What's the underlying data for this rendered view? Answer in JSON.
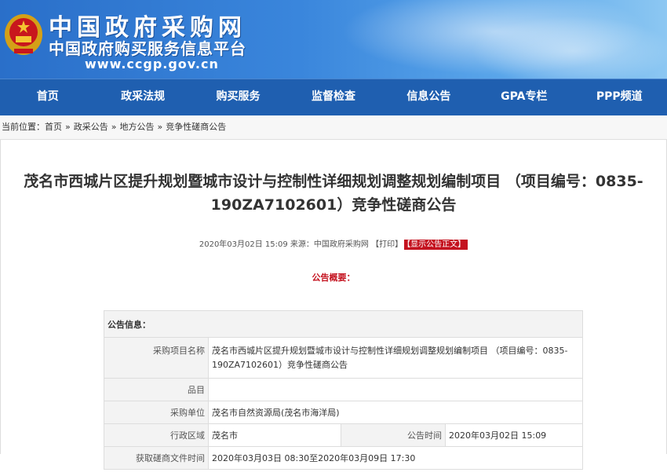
{
  "header": {
    "site_name": "中国政府采购网",
    "site_sub": "中国政府购买服务信息平台",
    "site_url": "www.ccgp.gov.cn"
  },
  "nav": {
    "items": [
      "首页",
      "政采法规",
      "购买服务",
      "监督检查",
      "信息公告",
      "GPA专栏",
      "PPP频道"
    ]
  },
  "breadcrumb": {
    "prefix": "当前位置：",
    "items": [
      "首页",
      "政采公告",
      "地方公告",
      "竞争性磋商公告"
    ],
    "separator": "»"
  },
  "article": {
    "title": "茂名市西城片区提升规划暨城市设计与控制性详细规划调整规划编制项目 （项目编号：0835-190ZA7102601）竞争性磋商公告",
    "meta_text": "2020年03月02日 15:09 来源：中国政府采购网 【打印】",
    "show_notice_button": "【显示公告正文】",
    "summary_label": "公告概要："
  },
  "info_table": {
    "heading": "公告信息：",
    "project_name_label": "采购项目名称",
    "project_name_value": "茂名市西城片区提升规划暨城市设计与控制性详细规划调整规划编制项目 （项目编号：0835-190ZA7102601）竞争性磋商公告",
    "item_label": "品目",
    "item_value": "",
    "purchaser_label": "采购单位",
    "purchaser_value": "茂名市自然资源局(茂名市海洋局)",
    "region_label": "行政区域",
    "region_value": "茂名市",
    "publish_time_label": "公告时间",
    "publish_time_value": "2020年03月02日 15:09",
    "doc_time_label": "获取磋商文件时间",
    "doc_time_value": "2020年03月03日 08:30至2020年03月09日 17:30"
  },
  "colors": {
    "nav_bg": "#1f5fb0",
    "accent_red": "#c4121f"
  }
}
